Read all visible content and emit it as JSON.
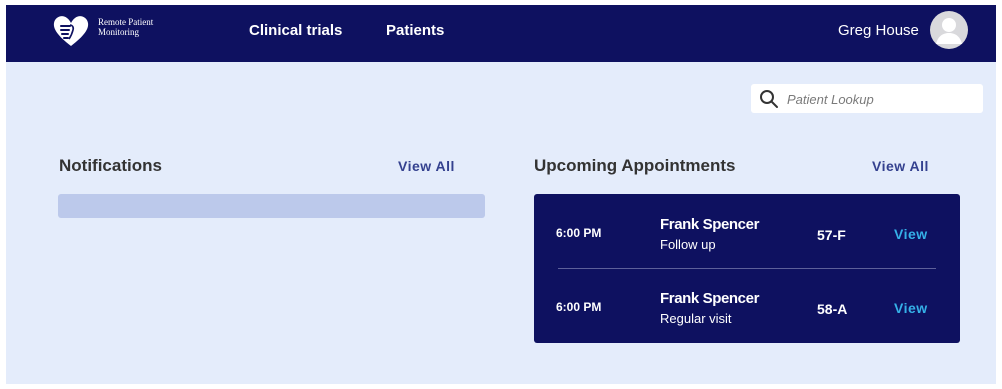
{
  "app": {
    "logo_line1": "Remote Patient",
    "logo_line2": "Monitoring",
    "brand_color": "#0e1160",
    "accent_color": "#35b1e8",
    "background_color": "#e4ecfb"
  },
  "nav": {
    "items": [
      {
        "label": "Clinical trials"
      },
      {
        "label": "Patients"
      }
    ],
    "user_name": "Greg House",
    "avatar_icon": "user-avatar-icon",
    "logo_icon": "heart-hand-icon"
  },
  "search": {
    "placeholder": "Patient Lookup",
    "value": "",
    "icon": "search-icon"
  },
  "notifications": {
    "title": "Notifications",
    "view_all": "View All"
  },
  "appointments": {
    "title": "Upcoming Appointments",
    "view_all": "View All",
    "items": [
      {
        "time": "6:00 PM",
        "name": "Frank Spencer",
        "type": "Follow up",
        "code": "57-F",
        "action": "View"
      },
      {
        "time": "6:00 PM",
        "name": "Frank Spencer",
        "type": "Regular visit",
        "code": "58-A",
        "action": "View"
      }
    ]
  }
}
